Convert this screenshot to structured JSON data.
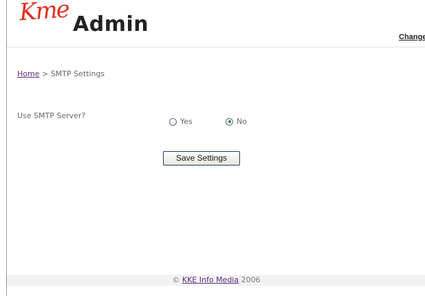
{
  "header": {
    "logo_script": "Kme",
    "logo_text": "Admin",
    "change_link": "Change"
  },
  "breadcrumb": {
    "home": "Home",
    "separator": " > ",
    "current": "SMTP Settings"
  },
  "form": {
    "question": "Use SMTP Server?",
    "options": [
      {
        "label": "Yes",
        "checked": false
      },
      {
        "label": "No",
        "checked": true
      }
    ],
    "save_label": "Save Settings"
  },
  "footer": {
    "copyright_symbol": "©",
    "company": "KKE Info Media",
    "year": "2006"
  }
}
